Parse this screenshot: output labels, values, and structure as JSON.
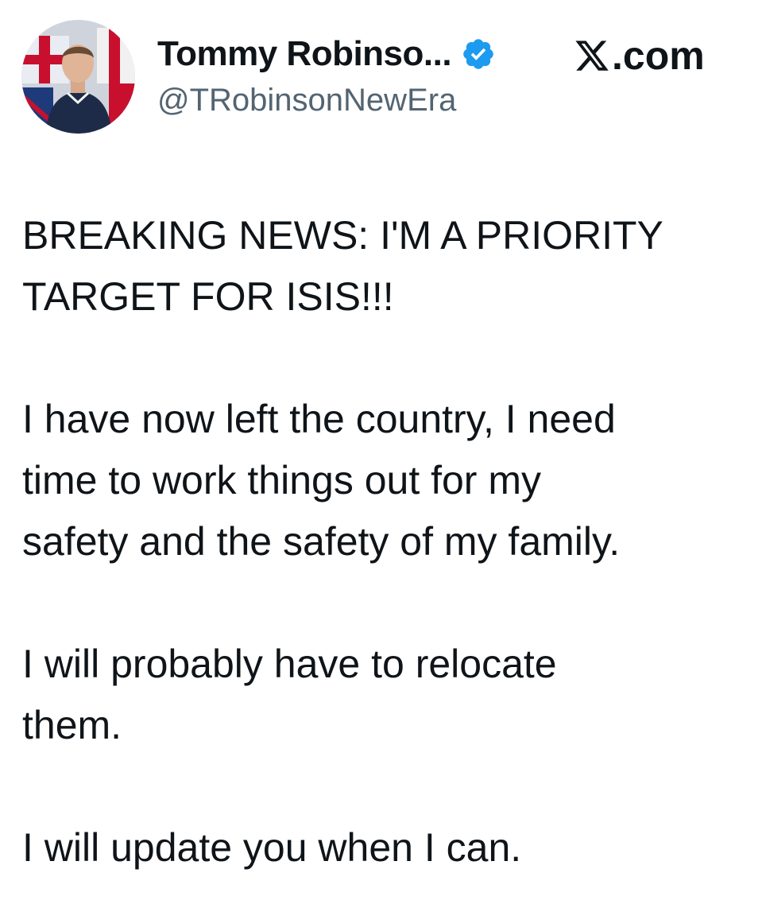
{
  "author": {
    "display_name": "Tommy Robinso...",
    "handle": "@TRobinsonNewEra",
    "verified": true,
    "verified_icon": "verified-badge-icon",
    "verified_color": "#1d9bf0"
  },
  "source": {
    "label": ".com",
    "logo_icon": "x-logo-icon"
  },
  "tweet": {
    "paragraphs": [
      "BREAKING NEWS: I'M A PRIORITY\nTARGET FOR ISIS!!!",
      "I have now left the country, I need\ntime to work things out for my\nsafety and the safety of my family.",
      "I will probably have to relocate\nthem.",
      "I will update you when I can."
    ]
  },
  "colors": {
    "text": "#0f1419",
    "secondary_text": "#536471",
    "background": "#ffffff"
  }
}
